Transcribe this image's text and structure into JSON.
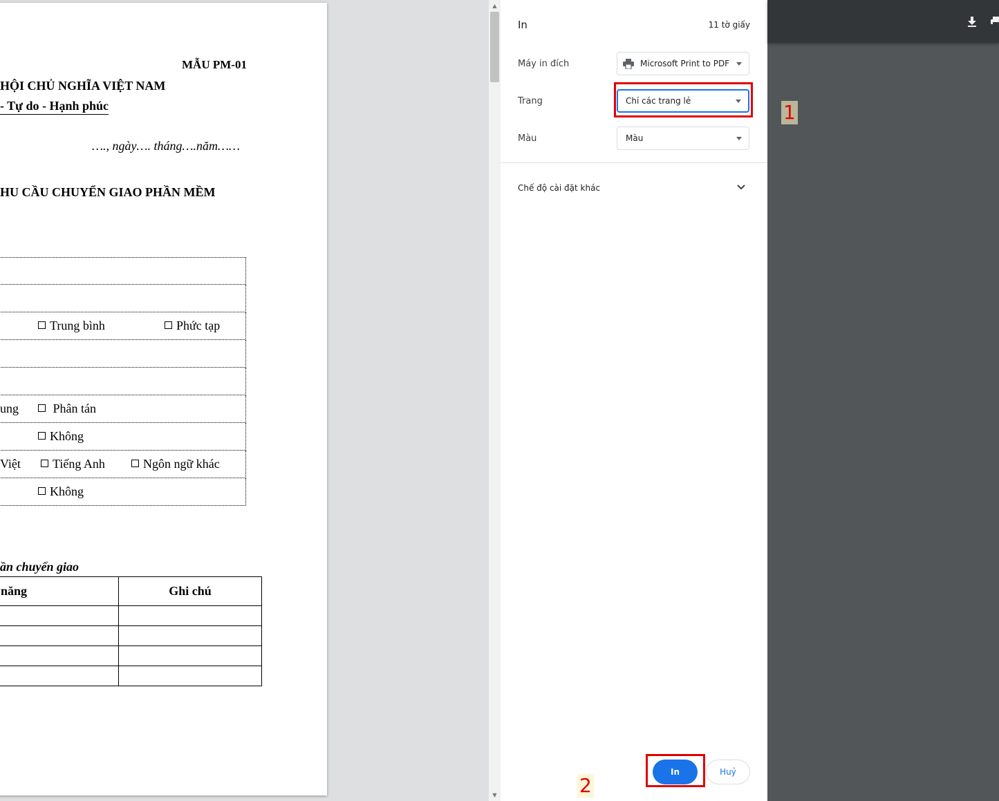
{
  "document": {
    "form_code": "MẪU PM-01",
    "nation_line": "HỘI CHỦ NGHĨA VIỆT NAM",
    "motto_line": "- Tự do - Hạnh phúc",
    "date_line": "…., ngày…. tháng….năm……",
    "doc_title": "HU CẦU CHUYỂN GIAO PHẦN MỀM",
    "opt_trung_binh": "Trung bình",
    "opt_phuc_tap": "Phức tạp",
    "opt_ung": "ung",
    "opt_phan_tan": "Phân tán",
    "opt_khong_1": "Không",
    "opt_viet": "Việt",
    "opt_tieng_anh": "Tiếng Anh",
    "opt_ngon_ngu_khac": "Ngôn ngữ khác",
    "opt_khong_2": "Không",
    "section_label": "ần chuyển giao",
    "table_headers": [
      "năng",
      "Ghi chú"
    ]
  },
  "panel": {
    "title": "In",
    "sheet_count": "11 tờ giấy",
    "destination_label": "Máy in đích",
    "destination_value": "Microsoft Print to PDF",
    "pages_label": "Trang",
    "pages_value": "Chỉ các trang lẻ",
    "color_label": "Màu",
    "color_value": "Màu",
    "more_settings": "Chế độ cài đặt khác",
    "print_button": "In",
    "cancel_button": "Huỷ"
  },
  "annotations": {
    "marker_1": "1",
    "marker_2": "2",
    "color": "#e00000"
  },
  "icons": {
    "printer": "printer-icon",
    "download": "download-icon",
    "print_toolbar": "print-icon",
    "chevron": "chevron-down-icon"
  }
}
